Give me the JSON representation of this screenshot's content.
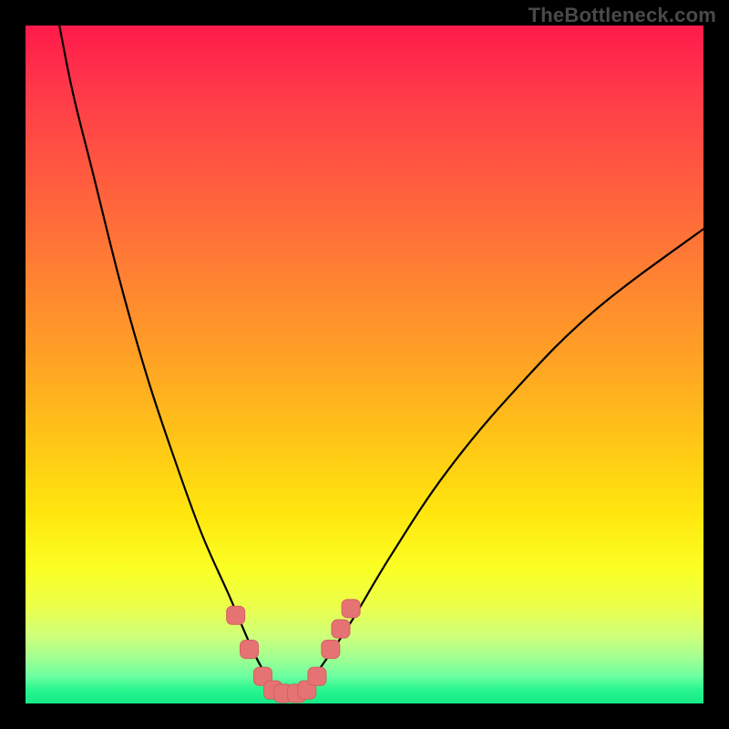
{
  "watermark": "TheBottleneck.com",
  "colors": {
    "frame": "#000000",
    "curve": "#000000",
    "marker_fill": "#e57373",
    "marker_stroke": "#d46060",
    "gradient_top": "#ff1a4a",
    "gradient_bottom": "#15e987"
  },
  "chart_data": {
    "type": "line",
    "title": "",
    "xlabel": "",
    "ylabel": "",
    "xlim": [
      0,
      100
    ],
    "ylim": [
      0,
      100
    ],
    "grid": false,
    "legend": false,
    "series": [
      {
        "name": "bottleneck-curve",
        "x": [
          5,
          7,
          10,
          14,
          18,
          22,
          26,
          30,
          33,
          35,
          37,
          38.5,
          40,
          42,
          44,
          48,
          54,
          62,
          72,
          84,
          100
        ],
        "y": [
          100,
          90,
          78,
          62,
          48,
          36,
          25,
          16,
          9,
          5,
          2.5,
          1.5,
          2,
          3.5,
          6,
          12,
          22,
          34,
          46,
          58,
          70
        ]
      }
    ],
    "markers": [
      {
        "x": 31,
        "y": 13
      },
      {
        "x": 33,
        "y": 8
      },
      {
        "x": 35,
        "y": 4
      },
      {
        "x": 36.5,
        "y": 2
      },
      {
        "x": 38,
        "y": 1.5
      },
      {
        "x": 40,
        "y": 1.5
      },
      {
        "x": 41.5,
        "y": 2
      },
      {
        "x": 43,
        "y": 4
      },
      {
        "x": 45,
        "y": 8
      },
      {
        "x": 46.5,
        "y": 11
      },
      {
        "x": 48,
        "y": 14
      }
    ],
    "annotations": []
  }
}
